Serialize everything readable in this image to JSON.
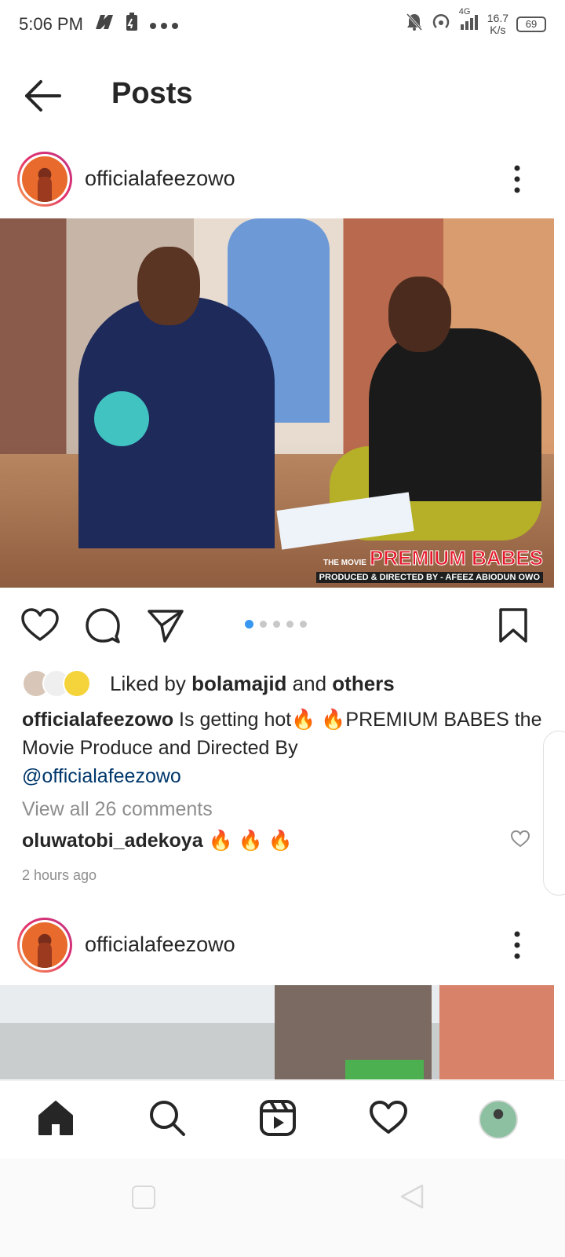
{
  "status_bar": {
    "time": "5:06 PM",
    "network": "4G",
    "speed_value": "16.7",
    "speed_unit": "K/s",
    "battery": "69",
    "icons": [
      "notification-n-icon",
      "battery-saver-icon",
      "more-dots-icon",
      "mute-icon",
      "hotspot-icon",
      "signal-icon"
    ]
  },
  "header": {
    "title": "Posts",
    "back_icon": "arrow-left-icon"
  },
  "post1": {
    "username": "officialafeezowo",
    "photo_caption": {
      "line1_small": "THE MOVIE",
      "line1_big": "PREMIUM BABES",
      "line2": "PRODUCED & DIRECTED BY - AFEEZ ABIODUN OWO"
    },
    "carousel_count": 5,
    "carousel_active": 1,
    "likes": {
      "prefix": "Liked by",
      "user": "bolamajid",
      "middle": "and",
      "suffix": "others"
    },
    "caption": {
      "username": "officialafeezowo",
      "text_1": "Is getting hot",
      "emoji": "🔥 🔥",
      "text_2": "PREMIUM BABES the Movie Produce and Directed By",
      "mention": "@officialafeezowo"
    },
    "view_comments": "View all 26 comments",
    "comment": {
      "username": "oluwatobi_adekoya",
      "text": "🔥 🔥 🔥"
    },
    "timestamp": "2 hours ago"
  },
  "post2": {
    "username": "officialafeezowo"
  },
  "bottom_nav": [
    "home-icon",
    "search-icon",
    "reels-icon",
    "activity-heart-icon",
    "profile-avatar"
  ],
  "colors": {
    "text": "#262626",
    "muted": "#8e8e8e",
    "mention": "#00376b",
    "carousel_active": "#3897f0",
    "ring_start": "#f9a94a",
    "ring_end": "#c13584"
  }
}
